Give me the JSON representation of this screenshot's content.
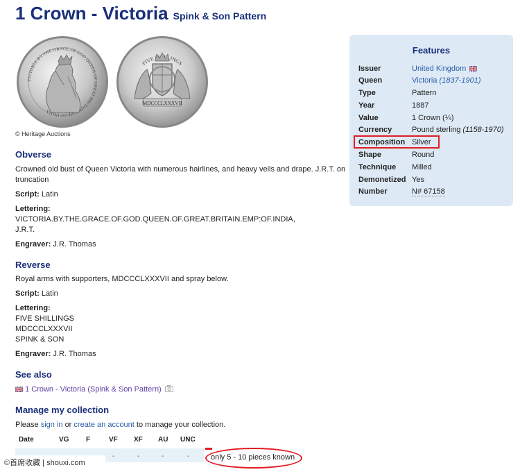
{
  "header": {
    "title": "1 Crown - Victoria",
    "subtitle": "Spink & Son Pattern"
  },
  "images": {
    "obverse_legend": "VICTORIA.BY.THE.GRACE.OF.GOD.QUEEN.OF.GREAT.BRITAIN.EMP:OF.INDIA",
    "reverse_top": "FIVE SHILLINGS",
    "reverse_bottom": "MDCCCLXXXVII",
    "photo_credit": "© Heritage Auctions"
  },
  "features": {
    "title": "Features",
    "rows": [
      {
        "key": "Issuer",
        "value": "United Kingdom"
      },
      {
        "key": "Queen",
        "value": "Victoria",
        "extra": "(1837-1901)"
      },
      {
        "key": "Type",
        "value": "Pattern"
      },
      {
        "key": "Year",
        "value": "1887"
      },
      {
        "key": "Value",
        "value": "1 Crown (¼)"
      },
      {
        "key": "Currency",
        "value": "Pound sterling",
        "extra": "(1158-1970)"
      },
      {
        "key": "Composition",
        "value": "Silver"
      },
      {
        "key": "Shape",
        "value": "Round"
      },
      {
        "key": "Technique",
        "value": "Milled"
      },
      {
        "key": "Demonetized",
        "value": "Yes"
      },
      {
        "key": "Number",
        "value": "N# 67158"
      }
    ]
  },
  "obverse": {
    "heading": "Obverse",
    "description_line1": "Crowned old bust of Queen Victoria with numerous hairlines, and heavy veils and drape. J.R.T. on",
    "description_line2": "truncation",
    "script_label": "Script:",
    "script_value": "Latin",
    "lettering_label": "Lettering:",
    "lettering_line1": "VICTORIA.BY.THE.GRACE.OF.GOD.QUEEN.OF.GREAT.BRITAIN.EMP:OF.INDIA,",
    "lettering_line2": "J.R.T.",
    "engraver_label": "Engraver:",
    "engraver_value": "J.R. Thomas"
  },
  "reverse": {
    "heading": "Reverse",
    "description": "Royal arms with supporters, MDCCCLXXXVII and spray below.",
    "script_label": "Script:",
    "script_value": "Latin",
    "lettering_label": "Lettering:",
    "lettering_line1": "FIVE SHILLINGS",
    "lettering_line2": "MDCCCLXXXVII",
    "lettering_line3": "SPINK & SON",
    "engraver_label": "Engraver:",
    "engraver_value": "J.R. Thomas"
  },
  "see_also": {
    "heading": "See also",
    "link": "1 Crown - Victoria (Spink & Son Pattern)"
  },
  "collection": {
    "heading": "Manage my collection",
    "prefix": "Please",
    "sign_in": "sign in",
    "or": "or",
    "create_account": "create an account",
    "suffix": "to manage your collection.",
    "columns": [
      "Date",
      "VG",
      "F",
      "VF",
      "XF",
      "AU",
      "UNC"
    ],
    "row_values": [
      "-",
      "-",
      "-",
      "-",
      "-"
    ],
    "known_text": "only 5 - 10 pieces known"
  },
  "watermark": "©首席收藏 | shouxi.com",
  "colors": {
    "title": "#1a2f7a",
    "link": "#2a5ea8",
    "panel_bg": "#dde9f5",
    "highlight_red": "#e21d23"
  }
}
